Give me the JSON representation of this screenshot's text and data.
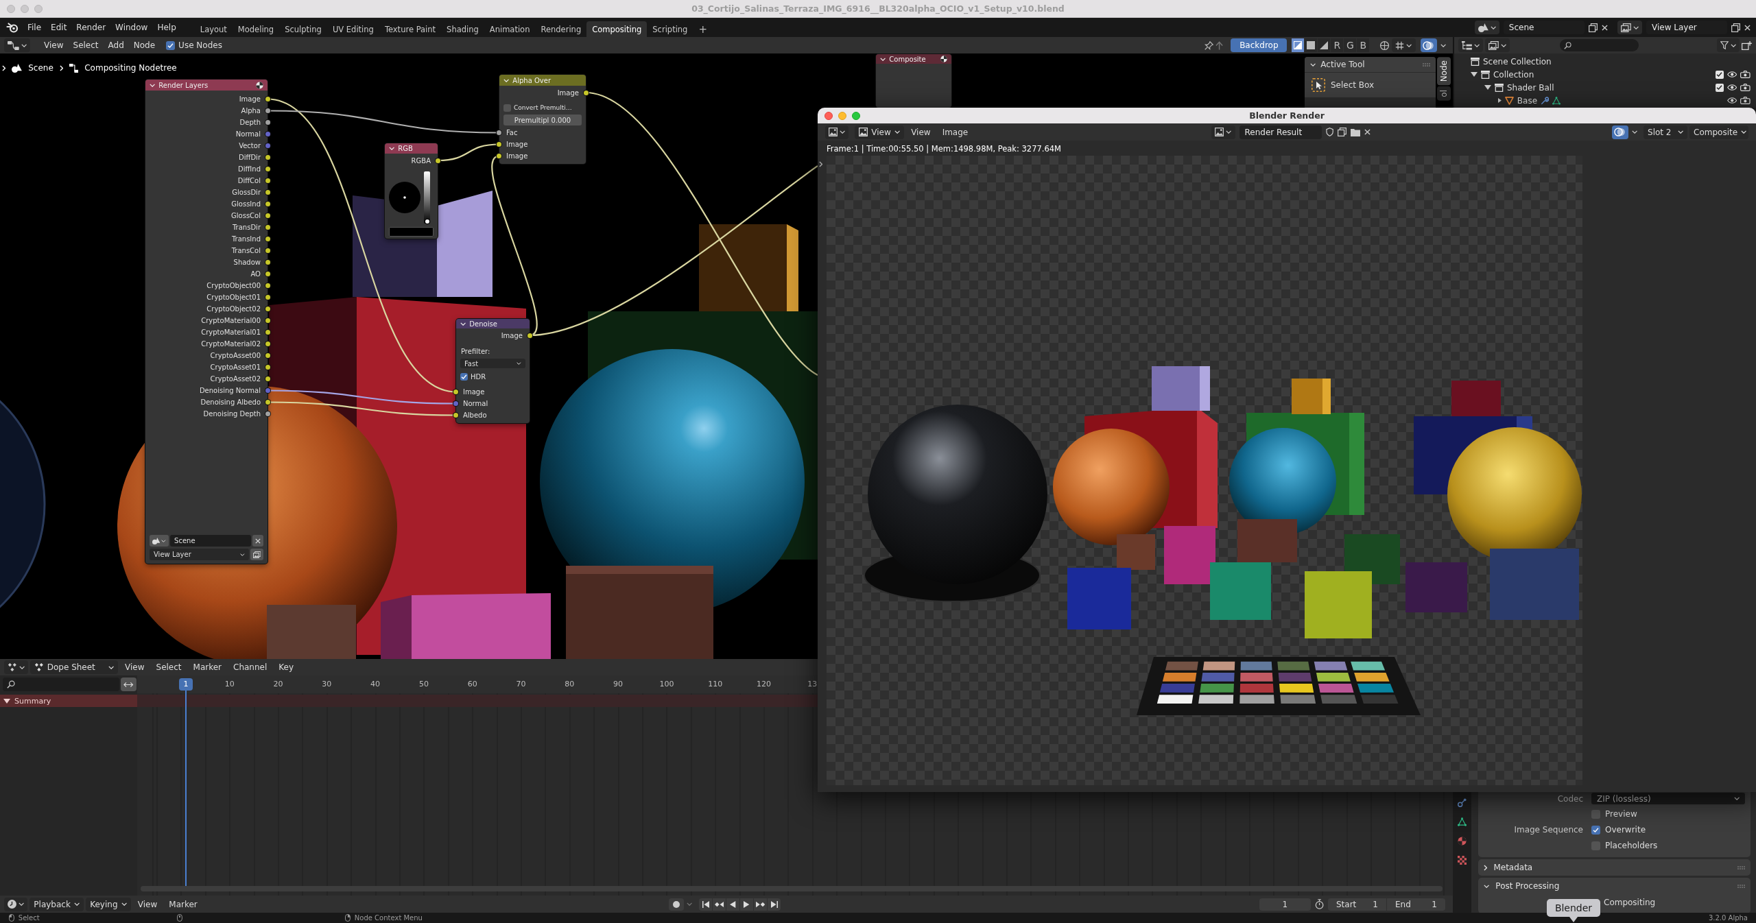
{
  "window": {
    "title": "03_Cortijo_Salinas_Terraza_IMG_6916__BL320alpha_OCIO_v1_Setup_v10.blend"
  },
  "topbar": {
    "menus": [
      "File",
      "Edit",
      "Render",
      "Window",
      "Help"
    ],
    "workspaces": [
      {
        "label": "Layout",
        "selected": false
      },
      {
        "label": "Modeling",
        "selected": false
      },
      {
        "label": "Sculpting",
        "selected": false
      },
      {
        "label": "UV Editing",
        "selected": false
      },
      {
        "label": "Texture Paint",
        "selected": false
      },
      {
        "label": "Shading",
        "selected": false
      },
      {
        "label": "Animation",
        "selected": false
      },
      {
        "label": "Rendering",
        "selected": false
      },
      {
        "label": "Compositing",
        "selected": true
      },
      {
        "label": "Scripting",
        "selected": false
      }
    ],
    "add_workspace": "+",
    "scene": "Scene",
    "view_layer": "View Layer"
  },
  "node_editor": {
    "menus": [
      "View",
      "Select",
      "Add",
      "Node"
    ],
    "use_nodes": {
      "label": "Use Nodes",
      "checked": true
    },
    "backdrop": {
      "label": "Backdrop",
      "on": true
    },
    "display_modes": [
      {
        "selected": true
      },
      {
        "selected": false
      },
      {
        "selected": false
      }
    ],
    "channels": [
      {
        "label": "R",
        "selected": false
      },
      {
        "label": "G",
        "selected": false
      },
      {
        "label": "B",
        "selected": false
      }
    ],
    "overlays": {
      "on": true
    },
    "breadcrumbs": [
      {
        "kind": "scene",
        "label": "Scene"
      },
      {
        "kind": "node_tree",
        "label": "Compositing Nodetree"
      }
    ],
    "nodes": [
      {
        "kind": "render_layers",
        "title": "Render Layers",
        "color": "#8e3a52",
        "outputs": [
          {
            "label": "Image",
            "kind": "color"
          },
          {
            "label": "Alpha",
            "kind": "value"
          },
          {
            "label": "Depth",
            "kind": "value"
          },
          {
            "label": "Normal",
            "kind": "vector"
          },
          {
            "label": "Vector",
            "kind": "vector"
          },
          {
            "label": "DiffDir",
            "kind": "color"
          },
          {
            "label": "DiffInd",
            "kind": "color"
          },
          {
            "label": "DiffCol",
            "kind": "color"
          },
          {
            "label": "GlossDir",
            "kind": "color"
          },
          {
            "label": "GlossInd",
            "kind": "color"
          },
          {
            "label": "GlossCol",
            "kind": "color"
          },
          {
            "label": "TransDir",
            "kind": "color"
          },
          {
            "label": "TransInd",
            "kind": "color"
          },
          {
            "label": "TransCol",
            "kind": "color"
          },
          {
            "label": "Shadow",
            "kind": "color"
          },
          {
            "label": "AO",
            "kind": "color"
          },
          {
            "label": "CryptoObject00",
            "kind": "color"
          },
          {
            "label": "CryptoObject01",
            "kind": "color"
          },
          {
            "label": "CryptoObject02",
            "kind": "color"
          },
          {
            "label": "CryptoMaterial00",
            "kind": "color"
          },
          {
            "label": "CryptoMaterial01",
            "kind": "color"
          },
          {
            "label": "CryptoMaterial02",
            "kind": "color"
          },
          {
            "label": "CryptoAsset00",
            "kind": "color"
          },
          {
            "label": "CryptoAsset01",
            "kind": "color"
          },
          {
            "label": "CryptoAsset02",
            "kind": "color"
          },
          {
            "label": "Denoising Normal",
            "kind": "vector"
          },
          {
            "label": "Denoising Albedo",
            "kind": "color"
          },
          {
            "label": "Denoising Depth",
            "kind": "value"
          }
        ],
        "scene": "Scene",
        "view_layer": "View Layer"
      },
      {
        "kind": "alpha_over",
        "title": "Alpha Over",
        "color": "#6c6e22",
        "outputs": [
          {
            "label": "Image",
            "kind": "color"
          }
        ],
        "convert": {
          "label": "Convert Premulti…",
          "checked": false
        },
        "premultiply": {
          "label": "Premultipl",
          "value": "0.000",
          "level": 0
        },
        "inputs": [
          {
            "label": "Fac",
            "kind": "value"
          },
          {
            "label": "Image",
            "kind": "color"
          },
          {
            "label": "Image",
            "kind": "color"
          }
        ]
      },
      {
        "kind": "rgb",
        "title": "RGB",
        "color": "#8e3a52",
        "outputs": [
          {
            "label": "RGBA",
            "kind": "color"
          }
        ],
        "value": {
          "level": 0
        },
        "swatch": {
          "color": "#000000"
        }
      },
      {
        "kind": "denoise",
        "title": "Denoise",
        "color": "#4b3a66",
        "outputs": [
          {
            "label": "Image",
            "kind": "color"
          }
        ],
        "prefilter": {
          "label": "Prefilter:",
          "value": "Fast"
        },
        "hdr": {
          "label": "HDR",
          "checked": true
        },
        "inputs": [
          {
            "label": "Image",
            "kind": "color"
          },
          {
            "label": "Normal",
            "kind": "vector"
          },
          {
            "label": "Albedo",
            "kind": "color"
          }
        ]
      },
      {
        "kind": "composite",
        "title": "Composite",
        "color": "#5e2a36"
      }
    ],
    "sidebar": {
      "panel": "Active Tool",
      "tool": "Select Box",
      "tabs": [
        {
          "label": "Node",
          "selected": true
        },
        {
          "label": "ol",
          "selected": false
        }
      ]
    }
  },
  "outliner": {
    "items": [
      {
        "kind": "scene_collection",
        "label": "Scene Collection",
        "children": [
          {
            "kind": "collection",
            "label": "Collection",
            "expanded": true,
            "checked": true,
            "children": [
              {
                "kind": "collection",
                "label": "Shader Ball",
                "expanded": true,
                "checked": true,
                "children": [
                  {
                    "kind": "object",
                    "label": "Base",
                    "expanded": false
                  }
                ]
              }
            ]
          }
        ]
      }
    ]
  },
  "render_window": {
    "title": "Blender Render",
    "view_mode": "View",
    "menus": [
      "View",
      "Image"
    ],
    "image": "Render Result",
    "overlays": {
      "on": true
    },
    "slot": "Slot 2",
    "layer": "Composite",
    "info": "Frame:1 | Time:00:55.50 | Mem:1498.98M, Peak: 3277.64M"
  },
  "dope_sheet": {
    "mode": "Dope Sheet",
    "menus": [
      "View",
      "Select",
      "Marker",
      "Channel",
      "Key"
    ],
    "current_frame": "1",
    "ticks": [
      "10",
      "20",
      "30",
      "40",
      "50",
      "60",
      "70",
      "80",
      "90",
      "100",
      "110",
      "120",
      "13"
    ],
    "channels": [
      {
        "label": "Summary",
        "expanded": true
      }
    ]
  },
  "timeline": {
    "dropdowns": [
      "Playback",
      "Keying"
    ],
    "menus": [
      "View",
      "Marker"
    ],
    "current_frame": "1",
    "start": {
      "label": "Start",
      "value": "1"
    },
    "end": {
      "label": "End",
      "value": "1"
    }
  },
  "properties": {
    "codec": {
      "label": "Codec",
      "value": "ZIP (lossless)"
    },
    "preview": {
      "label": "Preview",
      "checked": false
    },
    "image_sequence": {
      "label": "Image Sequence",
      "options": [
        {
          "label": "Overwrite",
          "checked": true
        },
        {
          "label": "Placeholders",
          "checked": false
        }
      ]
    },
    "panels": [
      {
        "label": "Metadata",
        "expanded": false
      },
      {
        "label": "Post Processing",
        "expanded": true,
        "rows": [
          "Compositing"
        ]
      }
    ]
  },
  "status_bar": {
    "items": [
      {
        "kind": "mouse_left",
        "label": "Select"
      },
      {
        "kind": "mouse_middle"
      },
      {
        "kind": "mouse_right",
        "label": "Node Context Menu"
      }
    ],
    "version": "3.2.0 Alpha"
  },
  "dock_tooltip": "Blender"
}
